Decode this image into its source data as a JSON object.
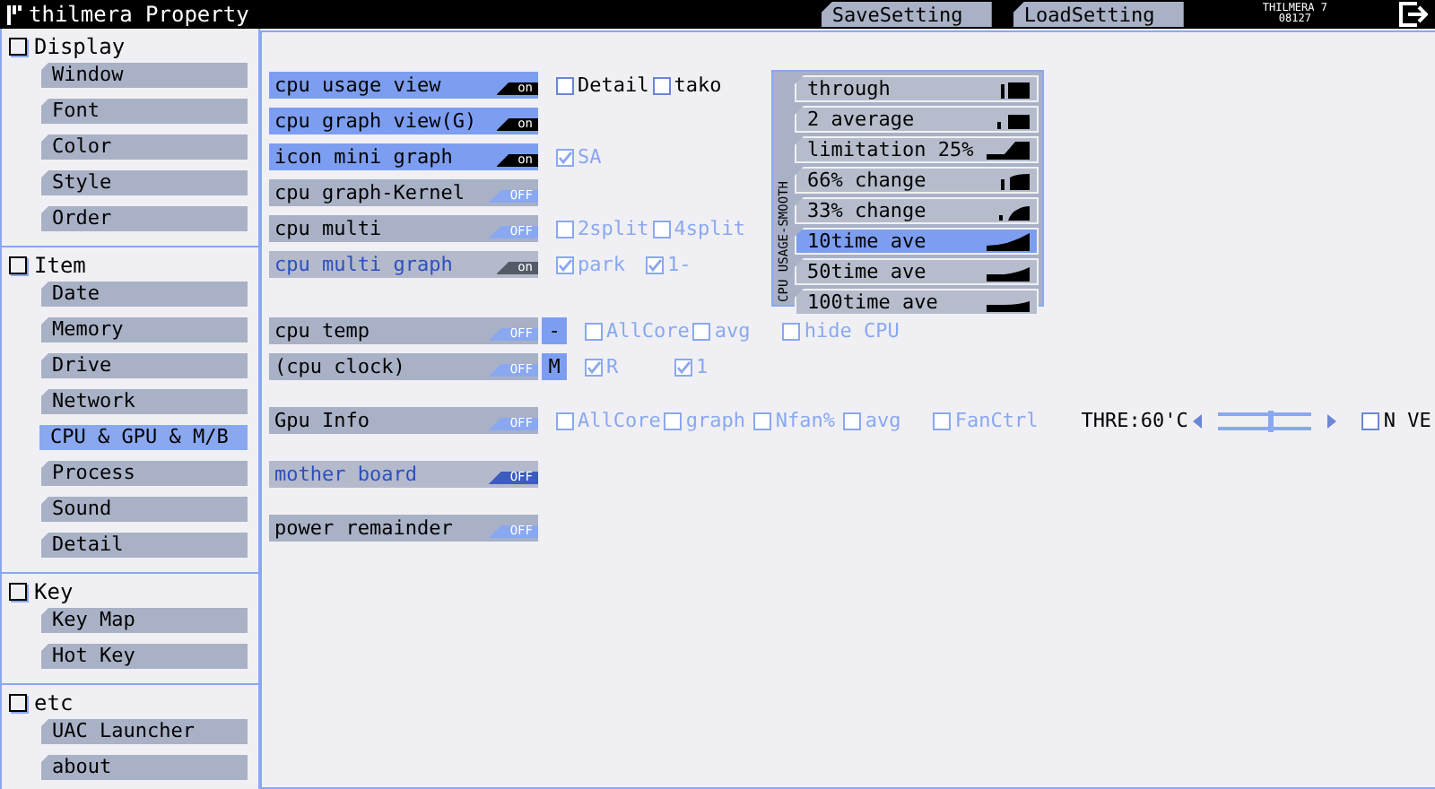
{
  "window": {
    "title": "thilmera Property"
  },
  "header_buttons": [
    {
      "label": "SaveSetting"
    },
    {
      "label": "LoadSetting"
    }
  ],
  "version": [
    "THILMERA 7",
    "08127"
  ],
  "sidebar": [
    {
      "label": "Display",
      "items": [
        {
          "label": "Window",
          "selected": false
        },
        {
          "label": "Font",
          "selected": false
        },
        {
          "label": "Color",
          "selected": false
        },
        {
          "label": "Style",
          "selected": false
        },
        {
          "label": "Order",
          "selected": false
        }
      ]
    },
    {
      "label": "Item",
      "items": [
        {
          "label": "Date",
          "selected": false
        },
        {
          "label": "Memory",
          "selected": false
        },
        {
          "label": "Drive",
          "selected": false
        },
        {
          "label": "Network",
          "selected": false
        },
        {
          "label": "CPU & GPU & M/B",
          "selected": true
        },
        {
          "label": "Process",
          "selected": false
        },
        {
          "label": "Sound",
          "selected": false
        },
        {
          "label": "Detail",
          "selected": false
        }
      ]
    },
    {
      "label": "Key",
      "items": [
        {
          "label": "Key Map",
          "selected": false
        },
        {
          "label": "Hot Key",
          "selected": false
        }
      ]
    },
    {
      "label": "etc",
      "items": [
        {
          "label": "UAC Launcher",
          "selected": false
        },
        {
          "label": "about",
          "selected": false
        }
      ]
    }
  ],
  "setting_groups": [
    [
      {
        "label": "cpu usage view",
        "on": true,
        "disabled": false,
        "switch": "on",
        "options": [
          {
            "kind": "checkbox",
            "label": "Detail",
            "checked": false,
            "disabled": false
          },
          {
            "kind": "checkbox",
            "label": "tako",
            "checked": false,
            "disabled": false
          }
        ]
      },
      {
        "label": "cpu graph view(G)",
        "on": true,
        "disabled": false,
        "switch": "on"
      },
      {
        "label": "icon mini graph",
        "on": true,
        "disabled": false,
        "switch": "on",
        "options": [
          {
            "kind": "checkbox",
            "label": "SA",
            "checked": true,
            "disabled": true
          }
        ]
      },
      {
        "label": "cpu graph-Kernel",
        "on": false,
        "disabled": false,
        "switch": "OFF"
      },
      {
        "label": "cpu multi",
        "on": false,
        "disabled": false,
        "switch": "OFF",
        "options": [
          {
            "kind": "checkbox",
            "label": "2split",
            "checked": false,
            "disabled": true
          },
          {
            "kind": "checkbox",
            "label": "4split",
            "checked": false,
            "disabled": true
          }
        ]
      },
      {
        "label": "cpu multi graph",
        "on": true,
        "disabled": true,
        "switch": "on",
        "options": [
          {
            "kind": "checkbox",
            "label": "park",
            "checked": true,
            "disabled": true
          },
          {
            "kind": "checkbox",
            "label": "1-",
            "checked": true,
            "disabled": true
          }
        ]
      }
    ],
    [
      {
        "label": "cpu temp",
        "on": false,
        "disabled": false,
        "switch": "OFF",
        "side_button": "-",
        "options": [
          {
            "kind": "checkbox",
            "label": "AllCore",
            "checked": false,
            "disabled": true
          },
          {
            "kind": "checkbox",
            "label": "avg",
            "checked": false,
            "disabled": true
          },
          {
            "kind": "checkbox",
            "label": "hide CPU",
            "checked": false,
            "disabled": true
          }
        ]
      },
      {
        "label": "(cpu clock)",
        "on": false,
        "disabled": false,
        "switch": "OFF",
        "side_button": "M",
        "options": [
          {
            "kind": "checkbox",
            "label": "R",
            "checked": true,
            "disabled": true
          },
          {
            "kind": "checkbox",
            "label": "1",
            "checked": true,
            "disabled": true
          }
        ]
      }
    ],
    [
      {
        "label": "Gpu Info",
        "on": false,
        "disabled": false,
        "switch": "OFF",
        "options": [
          {
            "kind": "checkbox",
            "label": "AllCore",
            "checked": false,
            "disabled": true
          },
          {
            "kind": "checkbox",
            "label": "graph",
            "checked": false,
            "disabled": true
          },
          {
            "kind": "checkbox",
            "label": "Nfan%",
            "checked": false,
            "disabled": true
          },
          {
            "kind": "checkbox",
            "label": "avg",
            "checked": false,
            "disabled": true
          },
          {
            "kind": "checkbox",
            "label": "FanCtrl",
            "checked": false,
            "disabled": true
          },
          {
            "kind": "slider",
            "label": "THRE:60'C",
            "level": 0.55
          },
          {
            "kind": "checkbox",
            "label": "N VE",
            "checked": false,
            "disabled": false
          }
        ]
      }
    ],
    [
      {
        "label": "mother board",
        "on": false,
        "disabled": true,
        "switch": "OFF"
      }
    ],
    [
      {
        "label": "power remainder",
        "on": false,
        "disabled": false,
        "switch": "OFF"
      }
    ]
  ],
  "smoothing": {
    "title": "CPU USAGE-SMOOTH",
    "items": [
      {
        "label": "through",
        "selected": false
      },
      {
        "label": "2 average",
        "selected": false
      },
      {
        "label": "limitation 25%",
        "selected": false
      },
      {
        "label": "66% change",
        "selected": false
      },
      {
        "label": "33% change",
        "selected": false
      },
      {
        "label": "10time ave",
        "selected": true
      },
      {
        "label": "50time ave",
        "selected": false
      },
      {
        "label": "100time ave",
        "selected": false
      }
    ]
  }
}
